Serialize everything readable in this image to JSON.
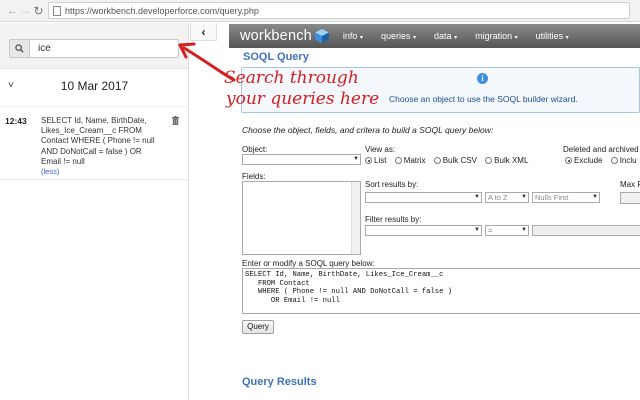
{
  "browser": {
    "url": "https://workbench.developerforce.com/query.php",
    "back_glyph": "←",
    "forward_glyph": "→",
    "reload_glyph": "↻"
  },
  "sidebar": {
    "search": {
      "value": "ice"
    },
    "collapse_glyph": "‹",
    "date_group": {
      "chevron": "˅",
      "date": "10 Mar 2017"
    },
    "entries": [
      {
        "time": "12:43",
        "query": "SELECT Id, Name, BirthDate, Likes_Ice_Cream__c FROM Contact WHERE ( Phone != null AND DoNotCall = false ) OR Email != null",
        "less_link": "(less)"
      }
    ]
  },
  "workbench": {
    "logo": "workbench",
    "menu": [
      {
        "label": "info",
        "caret": "▾"
      },
      {
        "label": "queries",
        "caret": "▾"
      },
      {
        "label": "data",
        "caret": "▾"
      },
      {
        "label": "migration",
        "caret": "▾"
      },
      {
        "label": "utilities",
        "caret": "▾"
      }
    ]
  },
  "main": {
    "title": "SOQL Query",
    "info_text": "Choose an object to use the SOQL builder wizard.",
    "instructions": "Choose the object, fields, and critera to build a SOQL query below:",
    "object_label": "Object:",
    "view_as": {
      "label": "View as:",
      "options": [
        "List",
        "Matrix",
        "Bulk CSV",
        "Bulk XML"
      ],
      "selected": "List"
    },
    "deleted": {
      "label": "Deleted and archived",
      "options": [
        "Exclude",
        "Inclu"
      ],
      "selected": "Exclude"
    },
    "fields_label": "Fields:",
    "sort": {
      "label": "Sort results by:",
      "direction": "A to Z",
      "nulls": "Nulls First"
    },
    "max_label": "Max R",
    "filter": {
      "label": "Filter results by:",
      "operator": "="
    },
    "query_label": "Enter or modify a SOQL query below:",
    "query_text": "SELECT Id, Name, BirthDate, Likes_Ice_Cream__c\n   FROM Contact\n   WHERE ( Phone != null AND DoNotCall = false )\n      OR Email != null",
    "query_button": "Query",
    "results_title": "Query Results"
  },
  "annotation": {
    "line1": "Search through",
    "line2": "your queries here",
    "color": "#d21f1f"
  }
}
